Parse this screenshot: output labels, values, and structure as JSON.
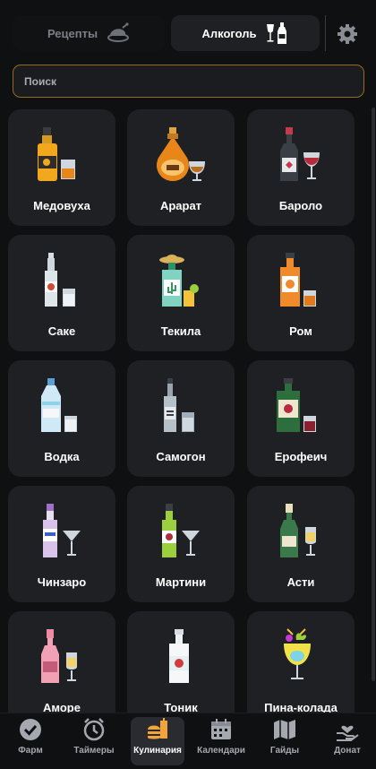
{
  "tabs": {
    "recipes": "Рецепты",
    "alcohol": "Алкоголь"
  },
  "search": {
    "placeholder": "Поиск"
  },
  "drinks": [
    {
      "label": "Медовуха"
    },
    {
      "label": "Арарат"
    },
    {
      "label": "Бароло"
    },
    {
      "label": "Саке"
    },
    {
      "label": "Текила"
    },
    {
      "label": "Ром"
    },
    {
      "label": "Водка"
    },
    {
      "label": "Самогон"
    },
    {
      "label": "Ерофеич"
    },
    {
      "label": "Чинзаро"
    },
    {
      "label": "Мартини"
    },
    {
      "label": "Асти"
    },
    {
      "label": "Аморе"
    },
    {
      "label": "Тоник"
    },
    {
      "label": "Пина-колада"
    }
  ],
  "nav": {
    "farm": "Фарм",
    "timers": "Таймеры",
    "cooking": "Кулинария",
    "calendars": "Календари",
    "guides": "Гайды",
    "donate": "Донат"
  },
  "colors": {
    "accent": "#f2a33a",
    "card": "#1f2024",
    "background": "#0f1012"
  }
}
